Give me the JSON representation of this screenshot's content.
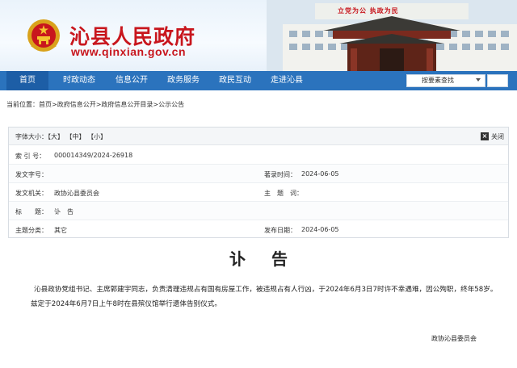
{
  "header": {
    "site_title": "沁县人民政府",
    "site_url": "www.qinxian.gov.cn",
    "building_slogan": "立党为公 执政为民"
  },
  "nav": {
    "items": [
      {
        "label": "首页",
        "active": true
      },
      {
        "label": "时政动态"
      },
      {
        "label": "信息公开"
      },
      {
        "label": "政务服务"
      },
      {
        "label": "政民互动"
      },
      {
        "label": "走进沁县"
      }
    ],
    "search_select": "按要素查找"
  },
  "breadcrumb": "当前位置：首页>政府信息公开>政府信息公开目录>公示公告",
  "info": {
    "font_size_label": "字体大小：【大】 【中】 【小】",
    "close_label": "关闭",
    "rows": [
      {
        "label": "索  引  号：",
        "value": "000014349/2024-26918",
        "label2": "",
        "value2": ""
      },
      {
        "label": "发文字号：",
        "value": "",
        "label2": "著录时间：",
        "value2": "2024-06-05"
      },
      {
        "label": "发文机关：",
        "value": "政协沁县委员会",
        "label2": "主　题　词：",
        "value2": ""
      },
      {
        "label": "标　　题：",
        "value": "讣　告",
        "label2": "",
        "value2": ""
      },
      {
        "label": "主题分类：",
        "value": "其它",
        "label2": "发布日期：",
        "value2": "2024-06-05"
      }
    ]
  },
  "article": {
    "title": "讣告",
    "body": "沁县政协党组书记、主席郭建宇同志，负责清理违规占有国有房屋工作，被违规占有人行凶，于2024年6月3日7时许不幸遇难，因公殉职，终年58岁。兹定于2024年6月7日上午8时在县殡仪馆举行遗体告别仪式。",
    "signature": "政协沁县委员会"
  },
  "colors": {
    "brand_red": "#c8161d",
    "nav_blue": "#2b73bd",
    "nav_active": "#1d5ea6"
  }
}
